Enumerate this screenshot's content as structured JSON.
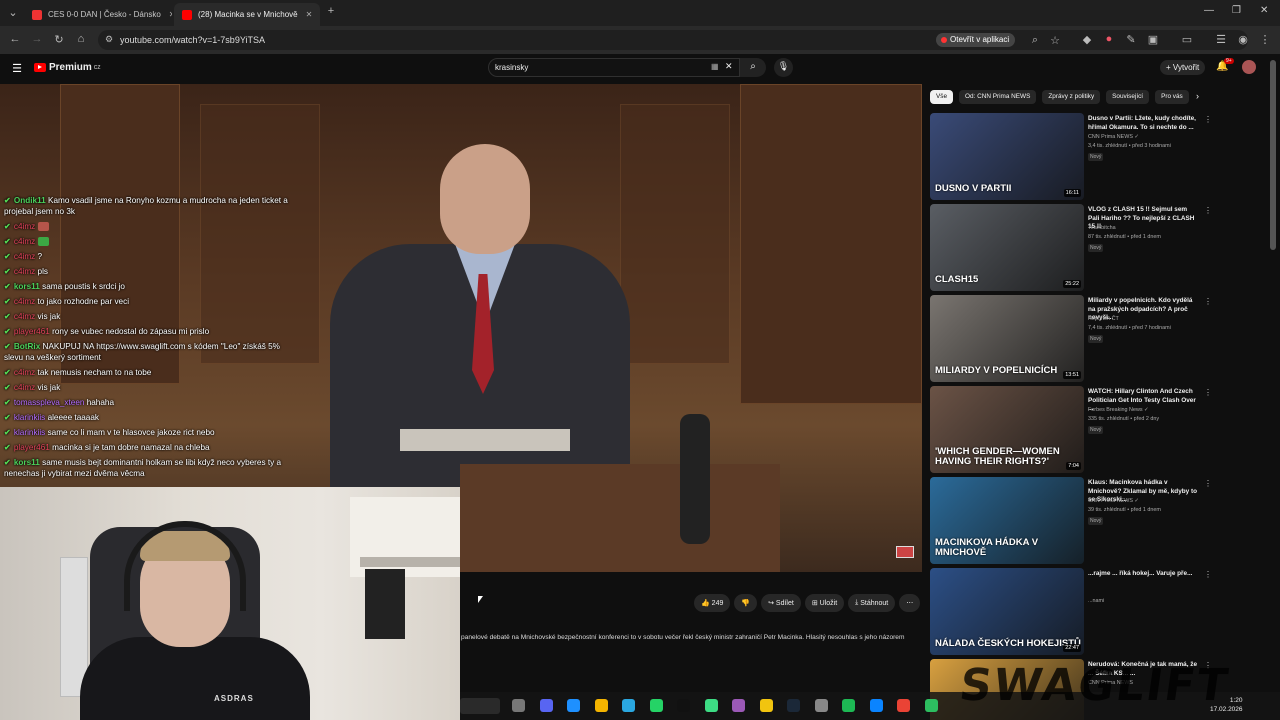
{
  "browser": {
    "tabs": [
      {
        "label": "CES 0-0 DAN | Česko - Dánsko",
        "active": false
      },
      {
        "label": "(28) Macinka se v Mnichově",
        "active": true
      }
    ],
    "url": "youtube.com/watch?v=1-7sb9YiTSA",
    "open_in_app": "Otevřít v aplikaci"
  },
  "youtube": {
    "logo": "Premium",
    "logo_superscript": "CZ",
    "search_value": "krasinsky",
    "create_label": "Vytvořit",
    "notif_badge": "9+"
  },
  "chat": [
    {
      "user": "Ondik11",
      "color": "green",
      "text": "Kamo vsadil jsme na Ronyho kozmu a mudrocha na jeden ticket a projebal jsem no 3k"
    },
    {
      "user": "c4imz",
      "color": "red",
      "text": "",
      "emote": "#b5554a"
    },
    {
      "user": "c4imz",
      "color": "red",
      "text": "",
      "emote": "#3ca844"
    },
    {
      "user": "c4imz",
      "color": "red",
      "text": "?"
    },
    {
      "user": "c4imz",
      "color": "red",
      "text": "pls"
    },
    {
      "user": "kors11",
      "color": "green",
      "text": "sama poustis k srdci jo"
    },
    {
      "user": "c4imz",
      "color": "red",
      "text": "to jako rozhodne par veci"
    },
    {
      "user": "c4imz",
      "color": "red",
      "text": "vis jak"
    },
    {
      "user": "player461",
      "color": "red",
      "text": "rony se vubec nedostal do zápasu mi prislo"
    },
    {
      "user": "BotRix",
      "color": "green",
      "text": "NAKUPUJ NA https://www.swaglift.com s kódem \"Leo\" získáš 5% slevu na veškerý sortiment"
    },
    {
      "user": "c4imz",
      "color": "red",
      "text": "tak nemusis necham to na tobe"
    },
    {
      "user": "c4imz",
      "color": "red",
      "text": "vis jak"
    },
    {
      "user": "tomasspleva_xteen",
      "color": "purple",
      "text": "hahaha"
    },
    {
      "user": "klarinkiis",
      "color": "purple",
      "text": "aleeee taaaak"
    },
    {
      "user": "klarinkiis",
      "color": "purple",
      "text": "same co li mam v te hlasovce jakoze rict nebo"
    },
    {
      "user": "player461",
      "color": "red",
      "text": "macinka si je tam dobre namazal na chleba"
    },
    {
      "user": "kors11",
      "color": "green",
      "text": "same musis bejt dominantni holkam se libi když neco vyberes ty a nenechas ji vybirat mezi dvěma věcma"
    }
  ],
  "video": {
    "likes": "249",
    "share": "Sdílet",
    "save": "Uložit",
    "download": "Stáhnout",
    "description": "panelové debatě na Mnichovské bezpečnostní konferenci to v sobotu večer řekl český ministr zahraničí Petr Macinka. Hlasitý nesouhlas s jeho názorem",
    "webcam_shirt_text": "ASDRAS"
  },
  "sidebar": {
    "chips": [
      "Vše",
      "Od: CNN Prima NEWS",
      "Zprávy z politiky",
      "Související",
      "Pro vás"
    ],
    "items": [
      {
        "title": "Dusno v Partii: Lžete, kudy chodíte, hřímal Okamura. To si nechte do ...",
        "channel": "CNN Prima NEWS ✓",
        "meta": "3,4 tis. zhlédnutí • před 3 hodinami",
        "badge": "Nový",
        "duration": "16:11",
        "caption": "DUSNO V PARTII",
        "thumb": "#3a4b78"
      },
      {
        "title": "VLOG z CLASH 15 !! Sejmul sem Pali Hariho ?? To nejlepší z CLASH 15 !!",
        "channel": "Teambitcha",
        "meta": "87 tis. zhlédnutí • před 1 dnem",
        "badge": "Nový",
        "duration": "25:22",
        "caption": "CLASH15",
        "thumb": "#5a5e64"
      },
      {
        "title": "Miliardy v popelnicích. Kdo vydělá na pražských odpadcích? A proč nevyšl...",
        "channel": "Reportéři ČT",
        "meta": "7,4 tis. zhlédnutí • před 7 hodinami",
        "badge": "Nový",
        "duration": "13:51",
        "caption": "MILIARDY V POPELNICÍCH",
        "thumb": "#7a7570"
      },
      {
        "title": "WATCH: Hillary Clinton And Czech Politician Get Into Testy Clash Over ...",
        "channel": "Forbes Breaking News ✓",
        "meta": "335 tis. zhlédnutí • před 2 dny",
        "badge": "Nový",
        "duration": "7:04",
        "caption": "'WHICH GENDER—WOMEN HAVING THEIR RIGHTS?'",
        "thumb": "#6b5346"
      },
      {
        "title": "Klaus: Macinkova hádka v Mnichově? Zklamal by mě, kdyby to se Sikorski...",
        "channel": "CNN Prima NEWS ✓",
        "meta": "39 tis. zhlédnutí • před 1 dnem",
        "badge": "Nový",
        "duration": "",
        "caption": "MACINKOVA HÁDKA V MNICHOVĚ",
        "thumb": "#2b6b9a"
      },
      {
        "title": "...rajme ... říká hokej... Varuje pře...",
        "channel": "",
        "meta": "...nami",
        "badge": "",
        "duration": "22:47",
        "caption": "NÁLADA ČESKÝCH HOKEJISTŮ",
        "thumb": "#2c4f86"
      },
      {
        "title": "Nerudová: Konečná je tak mamá, že ... Šéfka KS... ...",
        "channel": "CNN Prima NEWS",
        "meta": "",
        "badge": "",
        "duration": "",
        "caption": "",
        "thumb": "#d8a040"
      }
    ]
  },
  "taskbar": {
    "time": "1:20",
    "date": "17.02.2026"
  },
  "watermark": "SWAGLIFT"
}
